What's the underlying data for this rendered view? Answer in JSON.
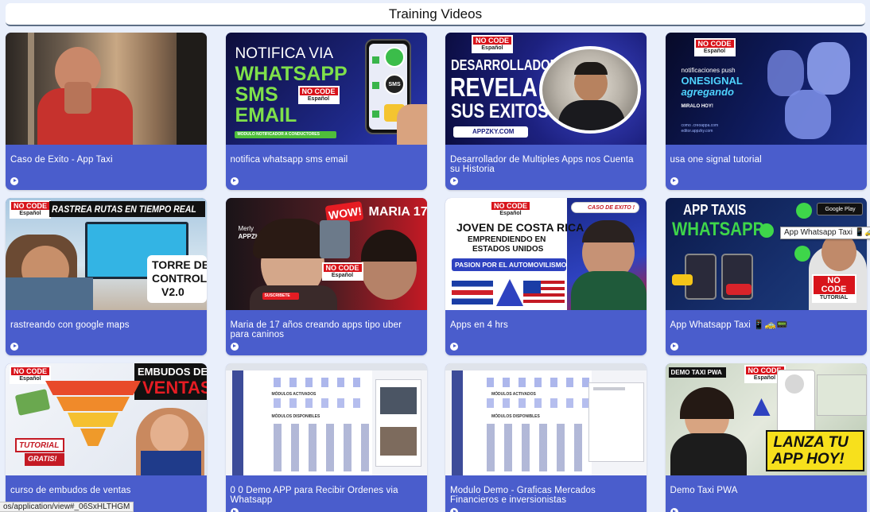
{
  "header": {
    "title": "Training Videos"
  },
  "videos": [
    {
      "title": "Caso de Exito - App Taxi"
    },
    {
      "title": "notifica whatsapp sms email",
      "thumb": {
        "line1": "NOTIFICA VIA",
        "line2": "WHATSAPP",
        "line3": "SMS",
        "line4": "EMAIL",
        "badge1": "NO CODE",
        "badge2": "Español",
        "caption": "MODULO NOTIFICADOR A CONDUCTORES",
        "sms": "SMS"
      }
    },
    {
      "title": "Desarrollador de Multiples Apps nos Cuenta su Historia",
      "thumb": {
        "badge1": "NO CODE",
        "badge2": "Español",
        "line1": "DESARROLLADOR",
        "line2": "REVELA",
        "line3": "SUS EXITOS",
        "site": "APPZKY.COM"
      }
    },
    {
      "title": "usa one signal tutorial",
      "thumb": {
        "badge1": "NO CODE",
        "badge2": "Español",
        "line1": "notificaciones push",
        "line2": "ONESIGNAL",
        "line3": "agregando",
        "cta": "MIRALO HOY!",
        "site1": "como .creoappa.com",
        "site2": "editor.appzky.com"
      }
    },
    {
      "title": "rastreando con google maps",
      "thumb": {
        "badge1": "NO CODE",
        "badge2": "Español",
        "line1": "RASTREA RUTAS EN TIEMPO REAL",
        "line2": "TORRE DE",
        "line3": "CONTROL",
        "line4": "V2.0"
      }
    },
    {
      "title": "Maria de 17 años creando apps tipo uber para caninos",
      "thumb": {
        "name1": "Merly",
        "name2": "APPZKY",
        "wow": "WOW!",
        "line1": "MARIA 17",
        "badge1": "NO CODE",
        "badge2": "Español",
        "sub": "SUSCRIBETE"
      }
    },
    {
      "title": "Apps en 4 hrs",
      "thumb": {
        "badge1": "NO CODE",
        "badge2": "Español",
        "tag": "CASO DE EXITO !",
        "line1": "JOVEN DE COSTA RICA",
        "line2": "EMPRENDIENDO EN",
        "line3": "ESTADOS UNIDOS",
        "line4": "PASION POR EL AUTOMOVILISMO"
      }
    },
    {
      "title": "App Whatsapp Taxi 📱🚕📟",
      "thumb": {
        "line1": "APP TAXIS",
        "line2": "WHATSAPP",
        "store": "Google Play",
        "badge1": "NO CODE",
        "badge2": "TUTORIAL"
      }
    },
    {
      "title": "curso de embudos de ventas",
      "thumb": {
        "badge1": "NO CODE",
        "badge2": "Español",
        "line1": "EMBUDOS DE",
        "line2": "VENTAS",
        "tag1": "TUTORIAL",
        "tag2": "GRATIS!"
      }
    },
    {
      "title": "0 0 Demo APP para Recibir Ordenes via Whatsapp",
      "thumb": {
        "h1": "MÓDULOS ACTIVADOS",
        "h2": "MÓDULOS DISPONIBLES"
      }
    },
    {
      "title": "Modulo Demo - Graficas Mercados Financieros e inversionistas",
      "thumb": {
        "h1": "MÓDULOS ACTIVADOS",
        "h2": "MÓDULOS DISPONIBLES"
      }
    },
    {
      "title": "Demo Taxi PWA",
      "thumb": {
        "line1": "DEMO TAXI PWA",
        "badge1": "NO CODE",
        "badge2": "Español",
        "cta1": "LANZA TU",
        "cta2": "APP HOY!"
      }
    }
  ],
  "tooltip": {
    "text": "App Whatsapp Taxi 📱🚕📟"
  },
  "status_bar": {
    "url": "os/application/view#_06SxHLTHGM"
  },
  "colors": {
    "card": "#4a5dcc",
    "background": "#e9effb",
    "badge": "#d8141b"
  },
  "icons": {
    "play": "play-circle-icon"
  }
}
